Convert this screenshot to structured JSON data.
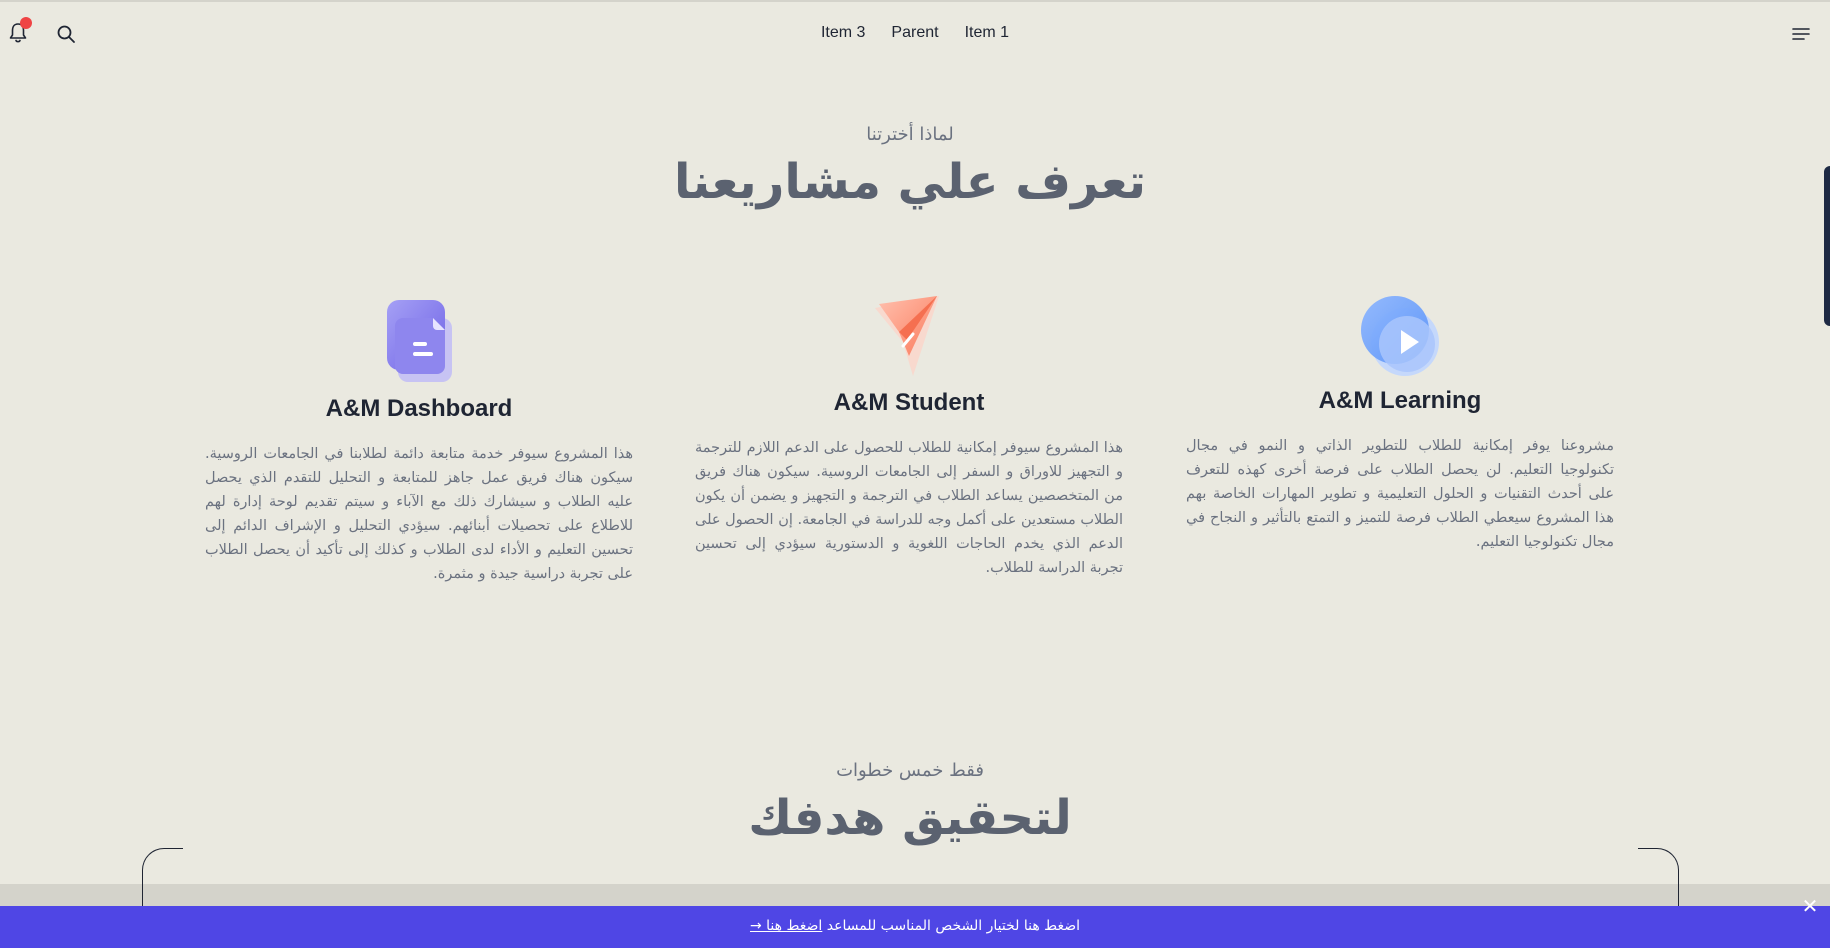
{
  "header": {
    "nav": [
      {
        "label": "Item 3"
      },
      {
        "label": "Parent"
      },
      {
        "label": "Item 1"
      }
    ],
    "notification_color": "#ef4444"
  },
  "projects_section": {
    "eyebrow": "لماذا أخترتنا",
    "title": "تعرف علي مشاريعنا",
    "cards": [
      {
        "title": "A&M Dashboard",
        "icon": "documents-icon",
        "description": "هذا المشروع سيوفر خدمة متابعة دائمة لطلابنا في الجامعات الروسية. سيكون هناك فريق عمل جاهز للمتابعة و التحليل للتقدم الذي يحصل عليه الطلاب و سيشارك ذلك مع الآباء و سيتم تقديم لوحة إدارة لهم للاطلاع على تحصيلات أبنائهم. سيؤدي التحليل و الإشراف الدائم إلى تحسين التعليم و الأداء لدى الطلاب و كذلك إلى تأكيد أن يحصل الطلاب على تجربة دراسية جيدة و مثمرة."
      },
      {
        "title": "A&M Student",
        "icon": "paper-plane-icon",
        "description": "هذا المشروع سيوفر إمكانية للطلاب للحصول على الدعم اللازم للترجمة و التجهيز للاوراق و السفر إلى الجامعات الروسية. سيكون هناك فريق من المتخصصين يساعد الطلاب في الترجمة و التجهيز و يضمن أن يكون الطلاب مستعدين على أكمل وجه للدراسة في الجامعة. إن الحصول على الدعم الذي يخدم الحاجات اللغوية و الدستورية سيؤدي إلى تحسين تجربة الدراسة للطلاب."
      },
      {
        "title": "A&M Learning",
        "icon": "play-video-icon",
        "description": "مشروعنا يوفر إمكانية للطلاب للتطوير الذاتي و النمو في مجال تكنولوجيا التعليم. لن يحصل الطلاب على فرصة أخرى كهذه للتعرف على أحدث التقنيات و الحلول التعليمية و تطوير المهارات الخاصة بهم هذا المشروع سيعطي الطلاب فرصة للتميز و التمتع بالتأثير و النجاح في مجال تكنولوجيا التعليم."
      }
    ]
  },
  "steps_section": {
    "eyebrow": "فقط خمس خطوات",
    "title": "لتحقيق هدفك"
  },
  "banner": {
    "text": "اضغط هنا لختيار الشخص المناسب للمساعد",
    "link": "اضغط هنا →",
    "close": "✕",
    "color": "#4f46e5"
  }
}
